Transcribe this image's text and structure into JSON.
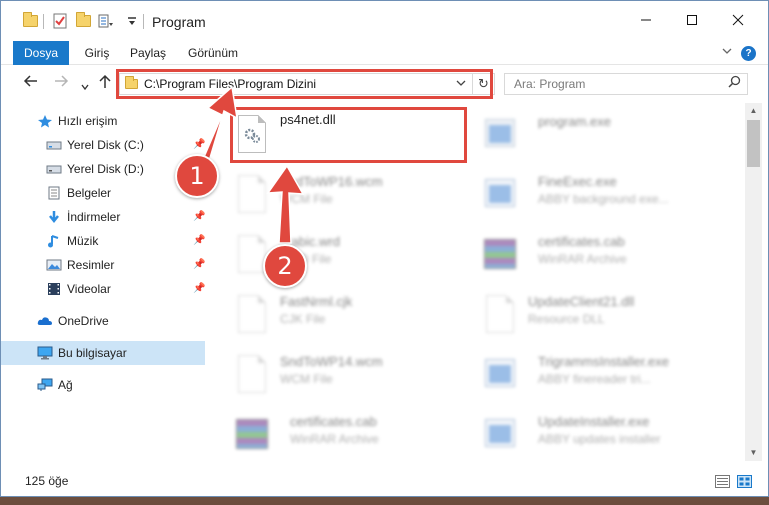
{
  "window": {
    "title": "Program"
  },
  "ribbon": {
    "tabs": [
      {
        "label": "Dosya",
        "active": true
      },
      {
        "label": "Giriş",
        "active": false
      },
      {
        "label": "Paylaş",
        "active": false
      },
      {
        "label": "Görünüm",
        "active": false
      }
    ],
    "help_label": "?"
  },
  "nav": {
    "address_path": "C:\\Program Files\\Program Dizini",
    "search_placeholder": "Ara: Program"
  },
  "sidebar": {
    "items": [
      {
        "label": "Hızlı erişim",
        "icon": "star-icon",
        "pinned": false
      },
      {
        "label": "Yerel Disk (C:)",
        "icon": "drive-icon",
        "pinned": true
      },
      {
        "label": "Yerel Disk (D:)",
        "icon": "drive-icon",
        "pinned": true
      },
      {
        "label": "Belgeler",
        "icon": "documents-icon",
        "pinned": true
      },
      {
        "label": "İndirmeler",
        "icon": "download-icon",
        "pinned": true
      },
      {
        "label": "Müzik",
        "icon": "music-icon",
        "pinned": true
      },
      {
        "label": "Resimler",
        "icon": "pictures-icon",
        "pinned": true
      },
      {
        "label": "Videolar",
        "icon": "video-icon",
        "pinned": true
      },
      {
        "label": "OneDrive",
        "icon": "cloud-icon",
        "pinned": false
      },
      {
        "label": "Bu bilgisayar",
        "icon": "computer-icon",
        "pinned": false,
        "selected": true
      },
      {
        "label": "Ağ",
        "icon": "network-icon",
        "pinned": false
      }
    ]
  },
  "files": [
    {
      "name": "ps4net.dll",
      "type": "",
      "icon": "dll-icon",
      "highlighted": true
    },
    {
      "name": "program.exe",
      "type": "",
      "icon": "exe-icon"
    },
    {
      "name": "SndToWP16.wcm",
      "type": "WCM File",
      "icon": "file-icon"
    },
    {
      "name": "FineExec.exe",
      "type": "ABBY background exe...",
      "icon": "exe-icon"
    },
    {
      "name": "arabic.wrd",
      "type": "WRD File",
      "icon": "file-icon"
    },
    {
      "name": "certificates.cab",
      "type": "WinRAR Archive",
      "icon": "rar-icon"
    },
    {
      "name": "FastNrml.cjk",
      "type": "CJK File",
      "icon": "file-icon"
    },
    {
      "name": "UpdateClient21.dll",
      "type": "Resource DLL",
      "icon": "dll-icon"
    },
    {
      "name": "SndToWP14.wcm",
      "type": "WCM File",
      "icon": "file-icon"
    },
    {
      "name": "TrigrammsInstaller.exe",
      "type": "ABBY finereader tri...",
      "icon": "exe-icon"
    },
    {
      "name": "certificates.cab",
      "type": "WinRAR Archive",
      "icon": "rar-icon"
    },
    {
      "name": "UpdateInstaller.exe",
      "type": "ABBY updates installer",
      "icon": "exe-icon"
    }
  ],
  "status": {
    "item_count": "125 öğe"
  },
  "callouts": [
    {
      "label": "1"
    },
    {
      "label": "2"
    }
  ],
  "colors": {
    "accent": "#1979ca",
    "highlight": "#e0483e",
    "selection": "#cce4f7"
  }
}
